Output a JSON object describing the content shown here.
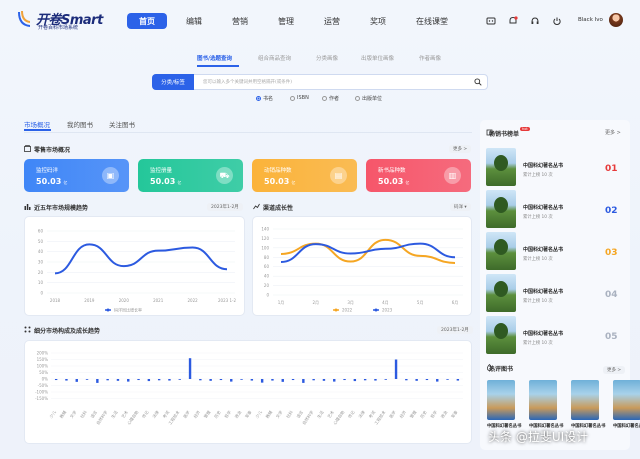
{
  "header": {
    "logo": "开卷Smart",
    "logo_sub": "开卷百科市场系统",
    "nav": [
      "首页",
      "编辑",
      "营销",
      "管理",
      "运营",
      "奖项",
      "在线课堂"
    ],
    "user": "Black Ivo"
  },
  "search": {
    "tabs": [
      "图书/选题查询",
      "组合商品查询",
      "分类画像",
      "出版单位画像",
      "作者画像"
    ],
    "button": "分类/标签",
    "placeholder": "您可以输入多个关键词并用空格隔开(或条件)",
    "options": [
      "书名",
      "ISBN",
      "作者",
      "出版单位"
    ]
  },
  "main_tabs": [
    "市场概况",
    "我的图书",
    "关注图书"
  ],
  "retail": {
    "title": "零售市场概况",
    "more": "更多 >",
    "cards": [
      {
        "label": "监控码洋",
        "value": "50.03",
        "unit": "亿",
        "color": "#3f86f7",
        "icon": "▣"
      },
      {
        "label": "监控册量",
        "value": "50.03",
        "unit": "亿",
        "color": "#24c79a",
        "icon": "⛟"
      },
      {
        "label": "动销品种数",
        "value": "50.03",
        "unit": "亿",
        "color": "#fbb33a",
        "icon": "▤"
      },
      {
        "label": "新书品种数",
        "value": "50.03",
        "unit": "亿",
        "color": "#f6566a",
        "icon": "▥"
      }
    ]
  },
  "trend": {
    "title": "近五年市场规模趋势",
    "range": "2023年1-2月"
  },
  "channel": {
    "title": "渠道成长性",
    "range": "码洋 ▾"
  },
  "segment": {
    "title": "细分市场构成及成长趋势",
    "range": "2023年1-2月"
  },
  "chart_data": [
    {
      "type": "line",
      "x": [
        "2018",
        "2019",
        "2020",
        "2021",
        "2022",
        "2023 1-2"
      ],
      "ylim": [
        0,
        60
      ],
      "series": [
        {
          "name": "码洋同比增长率",
          "color": "#2c5ae0",
          "values": [
            19,
            47,
            26,
            41,
            44,
            23
          ]
        }
      ]
    },
    {
      "type": "line",
      "x": [
        "1月",
        "2月",
        "3月",
        "4月",
        "5月",
        "6月"
      ],
      "ylim": [
        0,
        140
      ],
      "series": [
        {
          "name": "2022",
          "color": "#f5a623",
          "values": [
            87,
            109,
            71,
            117,
            83,
            68
          ]
        },
        {
          "name": "2023",
          "color": "#2c5ae0",
          "values": [
            70,
            108,
            88,
            98,
            109,
            80
          ]
        }
      ]
    },
    {
      "type": "bar",
      "ylim": [
        -200,
        200
      ],
      "yticks": [
        "200%",
        "150%",
        "100%",
        "50%",
        "0%",
        "-50%",
        "-100%",
        "-150%"
      ],
      "categories": [
        "少儿",
        "教辅",
        "文学",
        "社科",
        "语言",
        "自然科学",
        "生活",
        "艺术",
        "心理自助",
        "传记",
        "法律",
        "考试",
        "工程技术",
        "医学",
        "经济",
        "管理",
        "历史",
        "哲学",
        "政治",
        "军事",
        "少儿",
        "教辅",
        "文学",
        "社科",
        "语言",
        "自然科学",
        "生活",
        "艺术",
        "心理自助",
        "传记",
        "法律",
        "考试",
        "工程技术",
        "医学",
        "经济",
        "管理",
        "历史",
        "哲学",
        "政治",
        "军事"
      ],
      "values": [
        -8,
        -12,
        -22,
        -6,
        -30,
        -10,
        -14,
        -20,
        -8,
        -16,
        -10,
        -12,
        -6,
        160,
        -10,
        -14,
        -8,
        -20,
        -6,
        -12,
        -28,
        -12,
        -22,
        -8,
        -30,
        -10,
        -14,
        -20,
        -8,
        -16,
        -10,
        -12,
        -6,
        150,
        -10,
        -14,
        -8,
        -20,
        -6,
        -12
      ]
    }
  ],
  "right": {
    "title": "畅销书榜单",
    "more": "更多 >",
    "books": [
      {
        "title": "中国科幻著名丛书",
        "sub": "累计上榜 10 次",
        "rank": "01",
        "color": "#e63a3a"
      },
      {
        "title": "中国科幻著名丛书",
        "sub": "累计上榜 10 次",
        "rank": "02",
        "color": "#2c5ae0"
      },
      {
        "title": "中国科幻著名丛书",
        "sub": "累计上榜 10 次",
        "rank": "03",
        "color": "#f5a623"
      },
      {
        "title": "中国科幻著名丛书",
        "sub": "累计上榜 10 次",
        "rank": "04",
        "color": "#aab2c0"
      },
      {
        "title": "中国科幻著名丛书",
        "sub": "累计上榜 10 次",
        "rank": "05",
        "color": "#aab2c0"
      }
    ],
    "hot_title": "热评图书",
    "hot_more": "更多 >",
    "hot_books": [
      "中国科幻著名丛书",
      "中国科幻著名丛书",
      "中国科幻著名丛书",
      "中国科幻著名丛书"
    ]
  },
  "watermark": "头条 @拉斐UI设计"
}
